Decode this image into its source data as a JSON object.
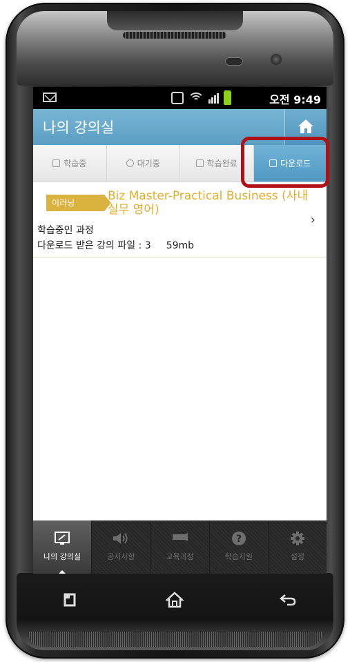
{
  "statusbar": {
    "mail_icon": "mail-icon",
    "time": "오전 9:49",
    "battery_color": "#8cd11a"
  },
  "header": {
    "title": "나의 강의실",
    "home_icon": "home-icon"
  },
  "tabs": [
    {
      "label": "학습중",
      "icon": "edit-icon",
      "active": false
    },
    {
      "label": "대기중",
      "icon": "search-icon",
      "active": false
    },
    {
      "label": "학습완료",
      "icon": "flag-icon",
      "active": false
    },
    {
      "label": "다운로드",
      "icon": "download-icon",
      "active": true
    }
  ],
  "course": {
    "badge": "이러닝",
    "title": "Biz Master-Practical Business (사내 실무 영어)",
    "status": "학습중인 과정",
    "files_label": "다운로드 받은 강의 파일 : 3",
    "files_size": "59mb"
  },
  "bottom_nav": [
    {
      "label": "나의 강의실",
      "icon": "classroom-icon",
      "active": true
    },
    {
      "label": "공지사항",
      "icon": "speaker-icon",
      "active": false
    },
    {
      "label": "교육과정",
      "icon": "course-icon",
      "active": false
    },
    {
      "label": "학습지원",
      "icon": "help-icon",
      "active": false
    },
    {
      "label": "설정",
      "icon": "gear-icon",
      "active": false
    }
  ],
  "colors": {
    "header_blue": "#5a9ec3",
    "active_tab": "#4f99c4",
    "badge_gold": "#d9b240",
    "course_title": "#e2ae2b",
    "highlight_red": "#b01016"
  }
}
